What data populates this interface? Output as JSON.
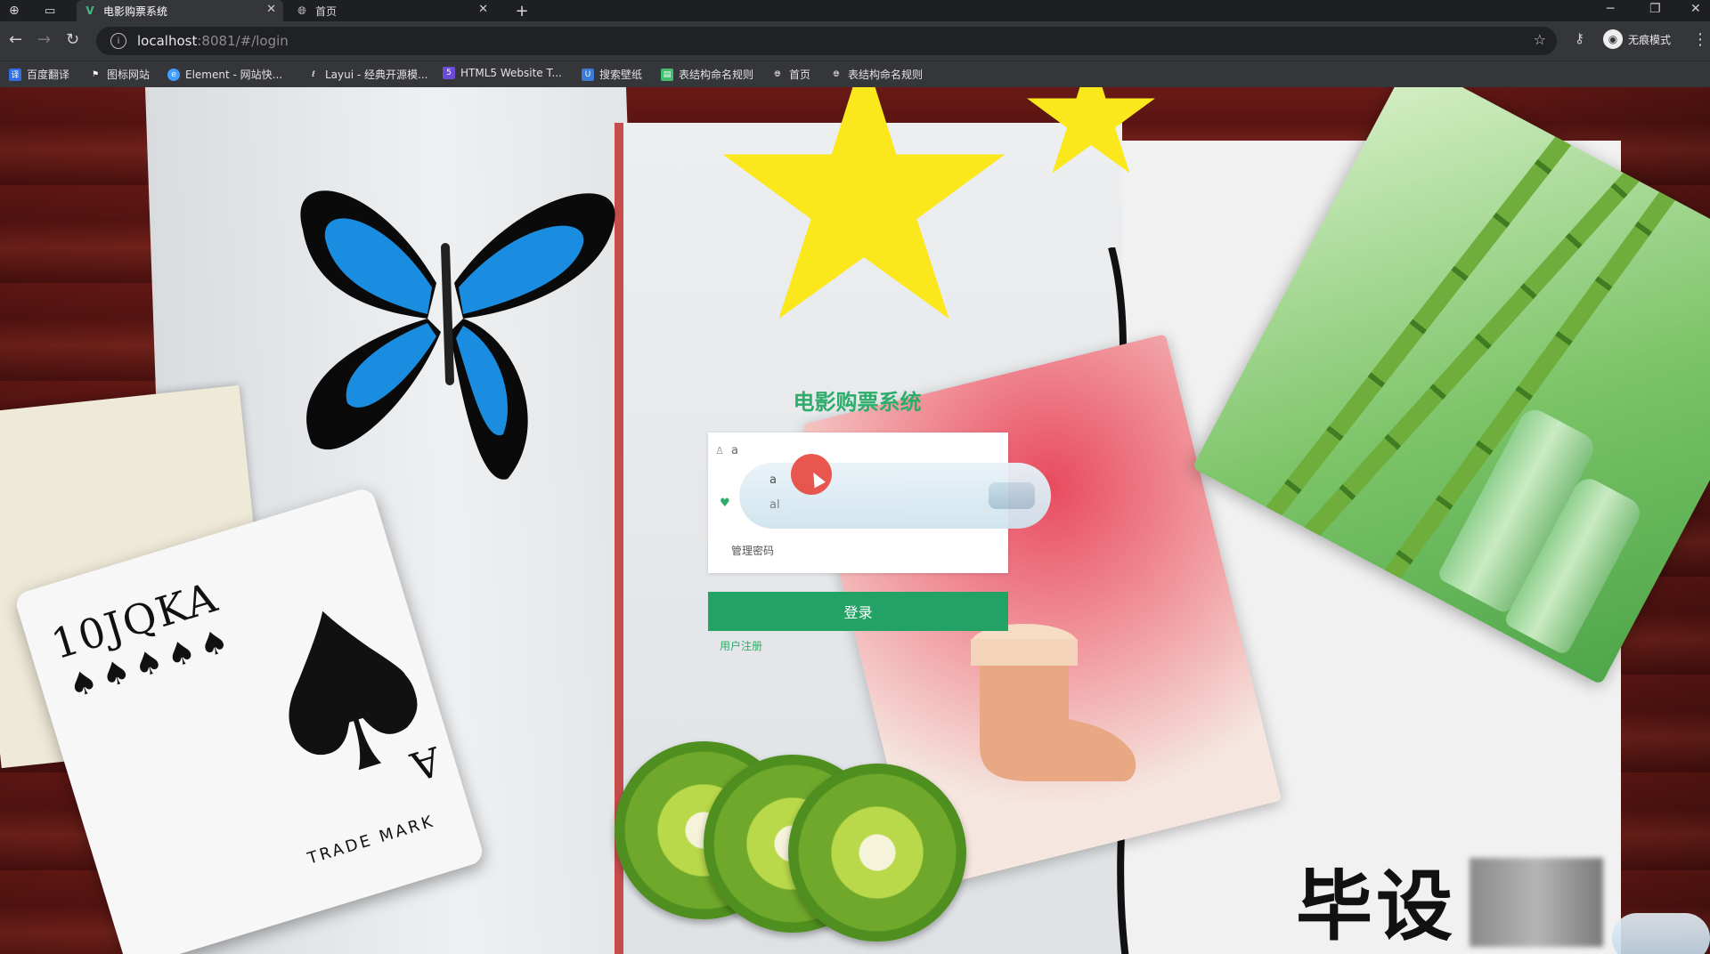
{
  "browser": {
    "tabs": [
      {
        "title": "电影购票系统",
        "active": true
      },
      {
        "title": "首页",
        "active": false
      }
    ],
    "new_tab_label": "+",
    "address": {
      "host": "localhost",
      "rest": ":8081/#/login"
    },
    "profile_label": "无痕模式",
    "bookmarks": [
      {
        "label": "百度翻译",
        "color": "#2f6fe4"
      },
      {
        "label": "图标网站",
        "color": "#444444"
      },
      {
        "label": "Element - 网站快...",
        "color": "#409eff"
      },
      {
        "label": "Layui - 经典开源模...",
        "color": "#555555"
      },
      {
        "label": "HTML5 Website T...",
        "color": "#6c4bd6"
      },
      {
        "label": "搜索壁纸",
        "color": "#3a7bd5"
      },
      {
        "label": "表结构命名规则",
        "color": "#3fbf6f"
      },
      {
        "label": "首页",
        "color": "#666666"
      },
      {
        "label": "表结构命名规则",
        "color": "#666666"
      }
    ]
  },
  "login": {
    "title": "电影购票系统",
    "username_value": "a",
    "password_placeholder": "管理密码",
    "autocomplete": [
      "a",
      "al"
    ],
    "login_button": "登录",
    "register_link": "用户注册"
  },
  "background": {
    "card_rank": "10JQKA",
    "card_suits": "♠♠♠♠♠",
    "card_trademark": "TRADE   MARK",
    "card_corner": "A",
    "watermark": "毕设"
  },
  "colors": {
    "accent": "#23a265",
    "title": "#2dac6a"
  }
}
